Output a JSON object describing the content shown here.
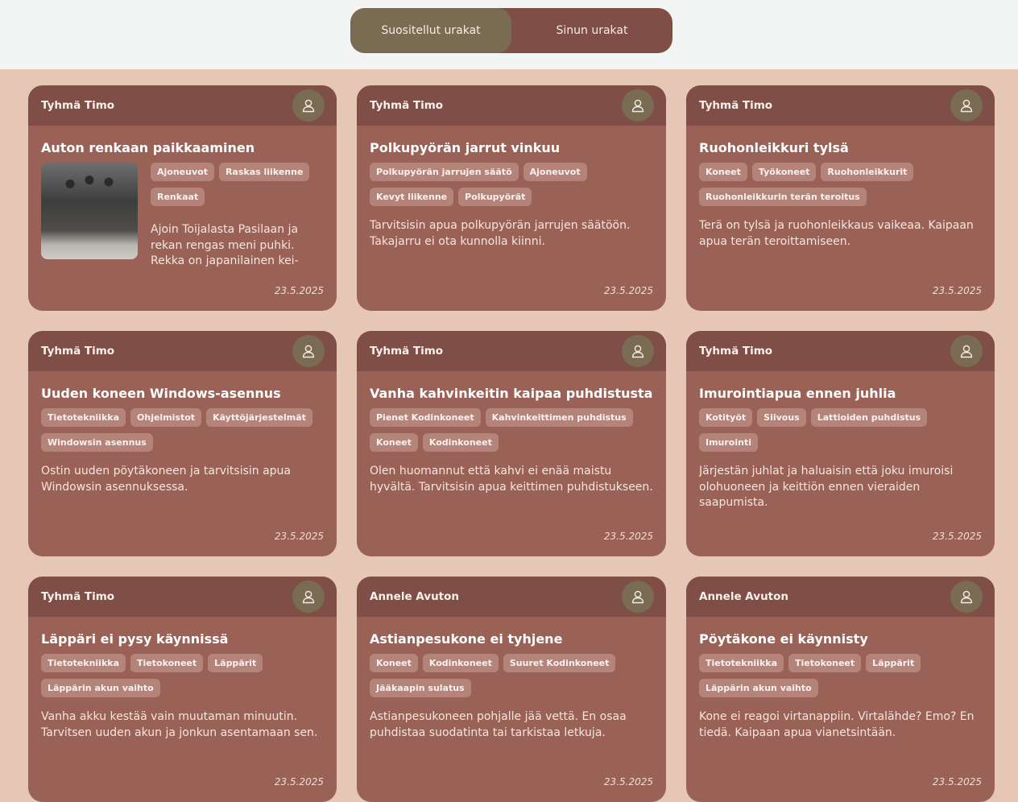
{
  "toggle": {
    "recommended": "Suositellut urakat",
    "mine": "Sinun urakat"
  },
  "cards": [
    {
      "author": "Tyhmä Timo",
      "title": "Auton renkaan paikkaaminen",
      "tags": [
        "Ajoneuvot",
        "Raskas liikenne",
        "Renkaat"
      ],
      "description": "Ajoin Toijalasta Pasilaan ja rekan rengas meni puhki. Rekka on japanilainen kei-rekka. Tarvitsisin jonkun paikkaamaan",
      "date": "23.5.2025",
      "has_image": true
    },
    {
      "author": "Tyhmä Timo",
      "title": "Polkupyörän jarrut vinkuu",
      "tags": [
        "Polkupyörän jarrujen säätö",
        "Ajoneuvot",
        "Kevyt liikenne",
        "Polkupyörät"
      ],
      "description": "Tarvitsisin apua polkupyörän jarrujen säätöön. Takajarru ei ota kunnolla kiinni.",
      "date": "23.5.2025"
    },
    {
      "author": "Tyhmä Timo",
      "title": "Ruohonleikkuri tylsä",
      "tags": [
        "Koneet",
        "Työkoneet",
        "Ruohonleikkurit",
        "Ruohonleikkurin terän teroitus"
      ],
      "description": "Terä on tylsä ja ruohonleikkaus vaikeaa. Kaipaan apua terän teroittamiseen.",
      "date": "23.5.2025"
    },
    {
      "author": "Tyhmä Timo",
      "title": "Uuden koneen Windows-asennus",
      "tags": [
        "Tietotekniikka",
        "Ohjelmistot",
        "Käyttöjärjestelmät",
        "Windowsin asennus"
      ],
      "description": "Ostin uuden pöytäkoneen ja tarvitsisin apua Windowsin asennuksessa.",
      "date": "23.5.2025"
    },
    {
      "author": "Tyhmä Timo",
      "title": "Vanha kahvinkeitin kaipaa puhdistusta",
      "tags": [
        "Pienet Kodinkoneet",
        "Kahvinkeittimen puhdistus",
        "Koneet",
        "Kodinkoneet"
      ],
      "description": "Olen huomannut että kahvi ei enää maistu hyvältä. Tarvitsisin apua keittimen puhdistukseen.",
      "date": "23.5.2025"
    },
    {
      "author": "Tyhmä Timo",
      "title": "Imurointiapua ennen juhlia",
      "tags": [
        "Kotityöt",
        "Siivous",
        "Lattioiden puhdistus",
        "Imurointi"
      ],
      "description": "Järjestän juhlat ja haluaisin että joku imuroisi olohuoneen ja keittiön ennen vieraiden saapumista.",
      "date": "23.5.2025"
    },
    {
      "author": "Tyhmä Timo",
      "title": "Läppäri ei pysy käynnissä",
      "tags": [
        "Tietotekniikka",
        "Tietokoneet",
        "Läppärit",
        "Läppärin akun vaihto"
      ],
      "description": "Vanha akku kestää vain muutaman minuutin. Tarvitsen uuden akun ja jonkun asentamaan sen.",
      "date": "23.5.2025"
    },
    {
      "author": "Annele Avuton",
      "title": "Astianpesukone ei tyhjene",
      "tags": [
        "Koneet",
        "Kodinkoneet",
        "Suuret Kodinkoneet",
        "Jääkaapin sulatus"
      ],
      "description": "Astianpesukoneen pohjalle jää vettä. En osaa puhdistaa suodatinta tai tarkistaa letkuja.",
      "date": "23.5.2025"
    },
    {
      "author": "Annele Avuton",
      "title": "Pöytäkone ei käynnisty",
      "tags": [
        "Tietotekniikka",
        "Tietokoneet",
        "Läppärit",
        "Läppärin akun vaihto"
      ],
      "description": "Kone ei reagoi virtanappiin. Virtalähde? Emo? En tiedä. Kaipaan apua vianetsintään.",
      "date": "23.5.2025"
    }
  ]
}
